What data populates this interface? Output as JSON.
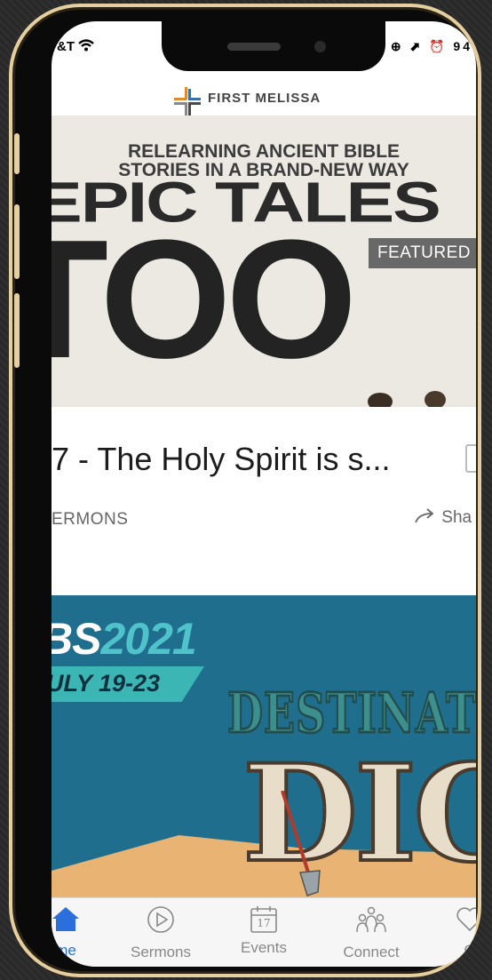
{
  "status_bar": {
    "carrier": "&T",
    "right": "⊕ ⬈ ⏰ 94"
  },
  "header": {
    "logo_text": "FIRST MELISSA"
  },
  "hero": {
    "subtitle_line1": "RELEARNING ANCIENT BIBLE",
    "subtitle_line2": "STORIES IN A BRAND-NEW WAY",
    "title_line1": "EPIC TALES",
    "title_line2": "TOO",
    "badge": "FEATURED"
  },
  "sermon_card": {
    "title": "7 - The Holy Spirit is s...",
    "category": "ERMONS",
    "share_label": "Sha"
  },
  "vbs": {
    "prefix": "BS",
    "year": "2021",
    "dates": "ULY 19-23",
    "destination": "DESTINATION",
    "dig": "DIG"
  },
  "tabs": [
    {
      "label": "me",
      "icon": "home-icon",
      "active": true
    },
    {
      "label": "Sermons",
      "icon": "play-circle-icon",
      "active": false
    },
    {
      "label": "Events",
      "icon": "calendar-icon",
      "active": false
    },
    {
      "label": "Connect",
      "icon": "people-icon",
      "active": false
    },
    {
      "label": "G",
      "icon": "heart-icon",
      "active": false
    }
  ],
  "calendar_day": "17",
  "colors": {
    "accent": "#2a6fdb",
    "vbs_blue": "#1f6e8e",
    "teal": "#3cb6b4",
    "frame_gold": "#e6cf9e"
  }
}
